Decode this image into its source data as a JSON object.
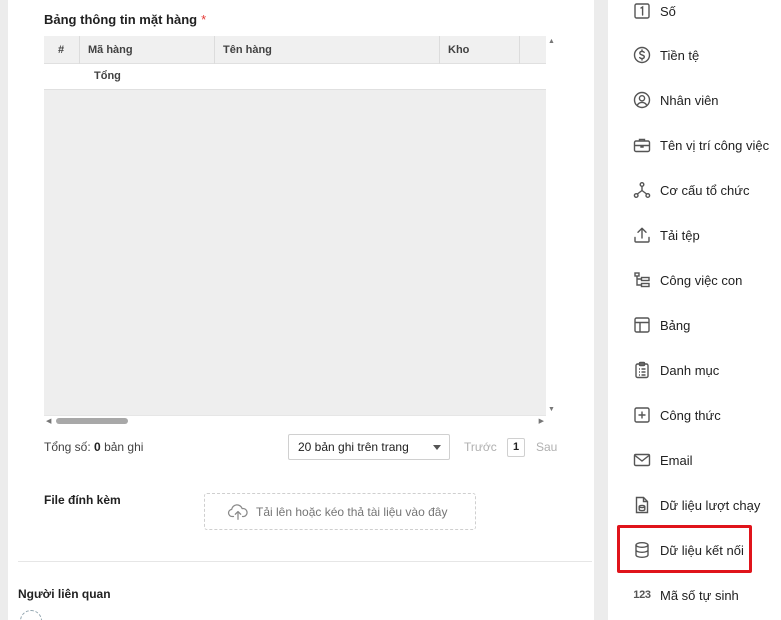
{
  "form": {
    "items_table_title": "Bảng thông tin mặt hàng",
    "required_mark": "*",
    "table": {
      "columns": [
        "#",
        "Mã hàng",
        "Tên hàng",
        "Kho",
        ""
      ],
      "total_row_label": "Tổng"
    },
    "pager": {
      "total_prefix": "Tổng số:",
      "total_count": "0",
      "total_suffix": "bản ghi",
      "page_size": "20 bản ghi trên trang",
      "prev": "Trước",
      "page": "1",
      "next": "Sau"
    },
    "attachments": {
      "label": "File đính kèm",
      "upload_text": "Tải lên hoặc kéo thả tài liệu vào đây"
    },
    "related_label": "Người liên quan"
  },
  "palette": {
    "items": [
      {
        "label": "Số",
        "icon": "number-1-icon"
      },
      {
        "label": "Tiền tệ",
        "icon": "dollar-icon"
      },
      {
        "label": "Nhân viên",
        "icon": "user-icon"
      },
      {
        "label": "Tên vị trí công việc",
        "icon": "briefcase-icon"
      },
      {
        "label": "Cơ cấu tổ chức",
        "icon": "org-structure-icon"
      },
      {
        "label": "Tải tệp",
        "icon": "upload-icon"
      },
      {
        "label": "Công việc con",
        "icon": "subtask-icon"
      },
      {
        "label": "Bảng",
        "icon": "table-icon"
      },
      {
        "label": "Danh mục",
        "icon": "clipboard-list-icon"
      },
      {
        "label": "Công thức",
        "icon": "plus-square-icon"
      },
      {
        "label": "Email",
        "icon": "mail-icon"
      },
      {
        "label": "Dữ liệu lượt chạy",
        "icon": "file-data-icon"
      },
      {
        "label": "Dữ liệu kết nối",
        "icon": "database-icon"
      },
      {
        "label": "Mã số tự sinh",
        "icon": "auto-number-icon",
        "icon_text": "123"
      }
    ],
    "highlighted_item": "Dữ liệu kết nối",
    "highlight_color": "#e0141b"
  }
}
